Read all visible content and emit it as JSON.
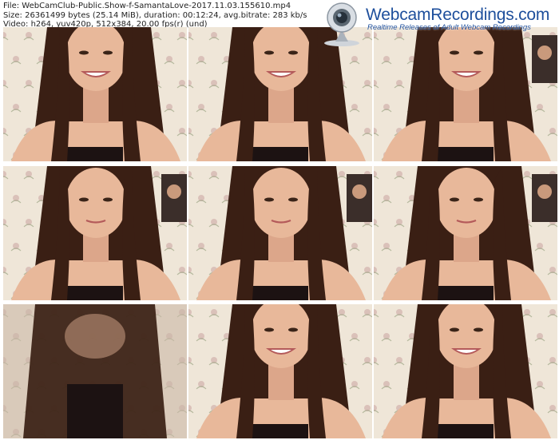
{
  "header": {
    "file_line": "File: WebCamClub-Public.Show-f-SamantaLove-2017.11.03.155610.mp4",
    "size_line": "Size: 26361499 bytes (25.14 MiB), duration: 00:12:24, avg.bitrate: 283 kb/s",
    "video_line": "Video: h264, yuv420p, 512x384, 20.00 fps(r) (und)"
  },
  "brand": {
    "logo_text": "WebcamRecordings.com",
    "tagline": "Realtime Releases of Adult Webcam Recordings"
  },
  "colors": {
    "brand_blue": "#1e4f9c",
    "wallpaper": "#efe6d8",
    "hair": "#3a1f14",
    "skin": "#e8b89a"
  },
  "thumbnails": [
    {
      "id": "thumb-1",
      "variant": "smile-close"
    },
    {
      "id": "thumb-2",
      "variant": "smile-close"
    },
    {
      "id": "thumb-3",
      "variant": "smile-poster"
    },
    {
      "id": "thumb-4",
      "variant": "face-poster"
    },
    {
      "id": "thumb-5",
      "variant": "face-poster"
    },
    {
      "id": "thumb-6",
      "variant": "face-poster"
    },
    {
      "id": "thumb-7",
      "variant": "hair-blur"
    },
    {
      "id": "thumb-8",
      "variant": "smile-wall"
    },
    {
      "id": "thumb-9",
      "variant": "smile-wall"
    }
  ]
}
